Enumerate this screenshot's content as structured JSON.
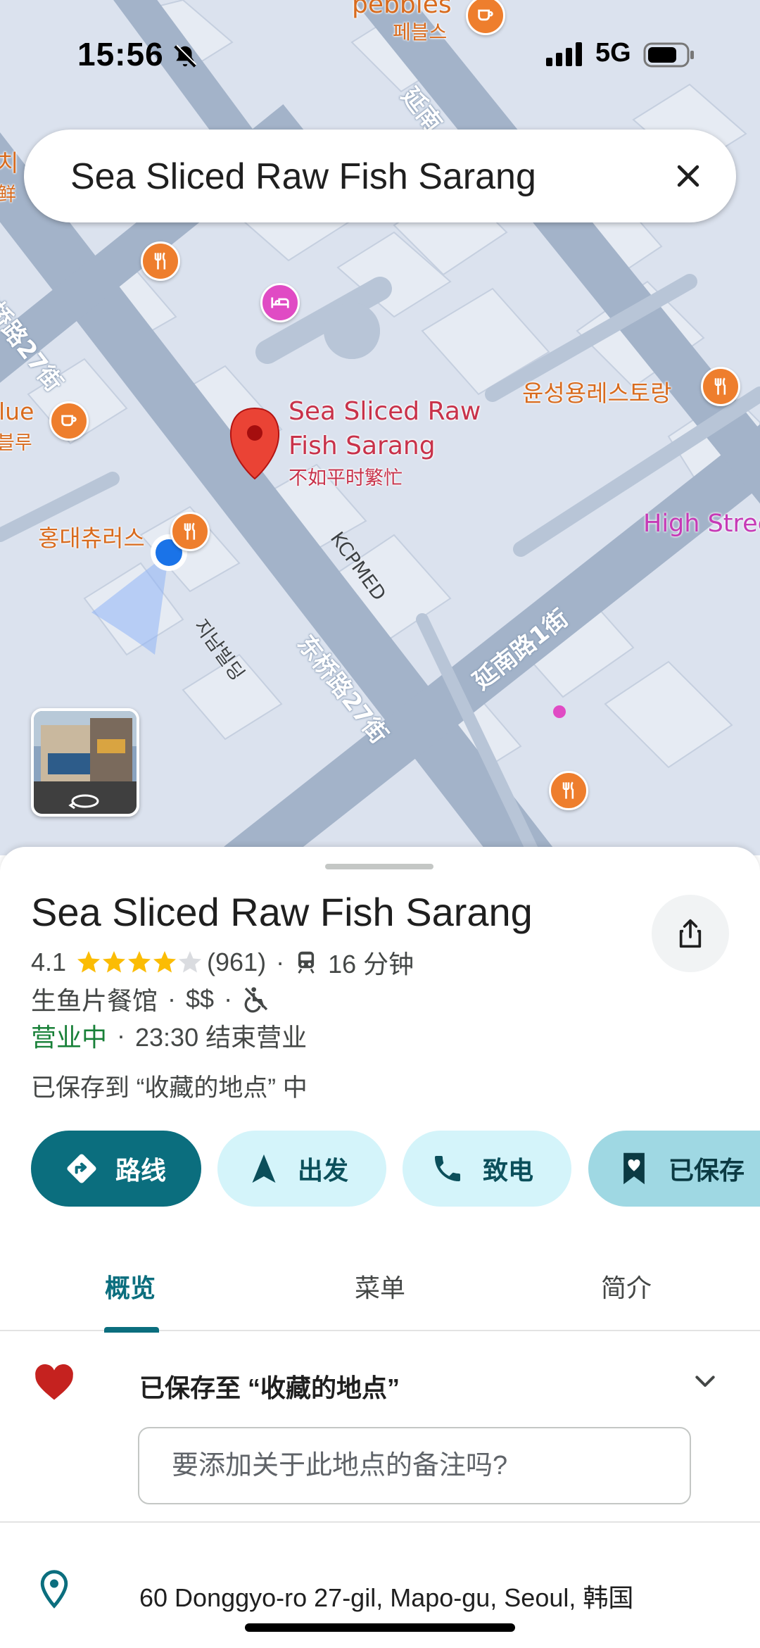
{
  "status_bar": {
    "time": "15:56",
    "network": "5G"
  },
  "search": {
    "query": "Sea Sliced Raw Fish Sarang"
  },
  "map": {
    "roads": {
      "dongyo_upper": "东桥路27街",
      "dongyo_lower": "东桥路27街",
      "yeonnam": "延南路1街",
      "yeonnam_top": "延南"
    },
    "pois": {
      "pebbles": "pebbles",
      "pebbles_ko": "페블스",
      "yunseong": "윤성용레스토랑",
      "blue": "lue",
      "blue_ko": "블루",
      "hongdae": "홍대츄러스",
      "high_street": "High Stree",
      "left_top_1": "치",
      "left_top_2": "鲜"
    },
    "selected_place": {
      "line1": "Sea Sliced Raw",
      "line2": "Fish Sarang",
      "sub": "不如平时繁忙"
    },
    "labels": {
      "kcpmed": "KCPMED",
      "building": "지남빌딩"
    }
  },
  "place": {
    "title": "Sea Sliced Raw Fish Sarang",
    "rating": "4.1",
    "stars": 4.1,
    "review_count": "(961)",
    "transit_time": "16 分钟",
    "category": "生鱼片餐馆",
    "price": "$$",
    "open_status": "营业中",
    "close_time": "23:30 结束营业",
    "saved_note": "已保存到 “收藏的地点” 中"
  },
  "actions": {
    "route": "路线",
    "start": "出发",
    "call": "致电",
    "saved": "已保存"
  },
  "tabs": {
    "overview": "概览",
    "menu": "菜单",
    "about": "简介"
  },
  "saved_list": {
    "label": "已保存至 “收藏的地点”",
    "note_placeholder": "要添加关于此地点的备注吗?"
  },
  "address": "60 Donggyo-ro 27-gil, Mapo-gu, Seoul, 韩国",
  "colors": {
    "accent": "#0b6e7e",
    "open": "#188038",
    "heart": "#c5221f",
    "pin": "#ea4335"
  }
}
